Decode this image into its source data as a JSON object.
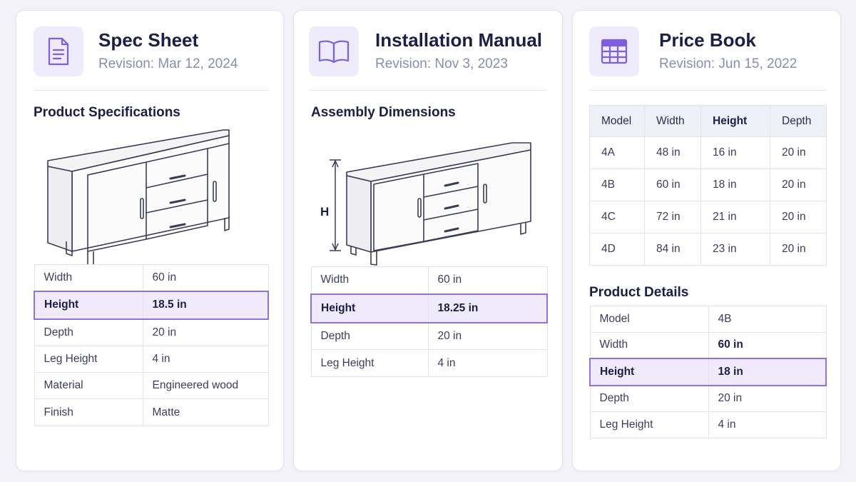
{
  "cards": [
    {
      "title": "Spec Sheet",
      "revision": "Revision: Mar 12, 2024",
      "icon": "document-icon",
      "section": "Product Specifications",
      "specs": [
        {
          "label": "Width",
          "value": "60 in"
        },
        {
          "label": "Height",
          "value": "18.5 in"
        },
        {
          "label": "Depth",
          "value": "20 in"
        },
        {
          "label": "Leg Height",
          "value": "4 in"
        },
        {
          "label": "Material",
          "value": "Engineered wood"
        },
        {
          "label": "Finish",
          "value": "Matte"
        }
      ]
    },
    {
      "title": "Installation Manual",
      "revision": "Revision: Nov 3, 2023",
      "icon": "book-icon",
      "section": "Assembly Dimensions",
      "dimension_label": "H",
      "specs": [
        {
          "label": "Width",
          "value": "60 in"
        },
        {
          "label": "Height",
          "value": "18.25 in"
        },
        {
          "label": "Depth",
          "value": "20 in"
        },
        {
          "label": "Leg Height",
          "value": "4 in"
        }
      ]
    },
    {
      "title": "Price Book",
      "revision": "Revision: Jun 15, 2022",
      "icon": "spreadsheet-icon",
      "table": {
        "headers": [
          "Model",
          "Width",
          "Height",
          "Depth"
        ],
        "rows": [
          [
            "4A",
            "48 in",
            "16 in",
            "20 in"
          ],
          [
            "4B",
            "60 in",
            "18 in",
            "20 in"
          ],
          [
            "4C",
            "72 in",
            "21 in",
            "20 in"
          ],
          [
            "4D",
            "84 in",
            "23 in",
            "20 in"
          ]
        ]
      },
      "details_title": "Product Details",
      "details": [
        {
          "label": "Model",
          "value": "4B"
        },
        {
          "label": "Width",
          "value": "60 in"
        },
        {
          "label": "Height",
          "value": "18 in"
        },
        {
          "label": "Depth",
          "value": "20 in"
        },
        {
          "label": "Leg Height",
          "value": "4 in"
        }
      ]
    }
  ],
  "colors": {
    "accent": "#8e72e0",
    "highlight_bg": "#efebfc",
    "icon_bg": "#eeebfb",
    "title": "#1c1e45",
    "muted": "#8a8ea8"
  }
}
